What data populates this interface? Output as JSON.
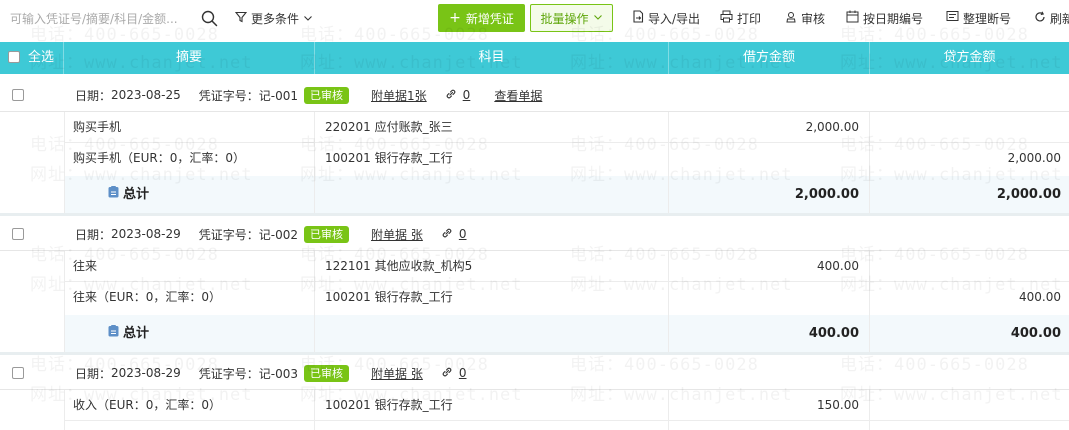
{
  "toolbar": {
    "search_placeholder": "可输入凭证号/摘要/科目/金额...",
    "more_filters": "更多条件",
    "new_voucher": "新增凭证",
    "new_plus": "+",
    "batch_ops": "批量操作",
    "import_export": "导入/导出",
    "print": "打印",
    "audit": "审核",
    "by_date_number": "按日期编号",
    "arrange_gaps": "整理断号",
    "refresh": "刷新"
  },
  "table_header": {
    "select_all": "全选",
    "summary": "摘要",
    "account": "科目",
    "debit": "借方金额",
    "credit": "贷方金额"
  },
  "labels": {
    "date_prefix": "日期：",
    "voucher_prefix": "凭证字号：",
    "total": "总计"
  },
  "watermark": {
    "phone": "电话：400-665-0028",
    "site": "网址：www.chanjet.net"
  },
  "vouchers": [
    {
      "date": "2023-08-25",
      "number": "记-001",
      "status": "已审核",
      "attachments": "附单据1张",
      "link_count": "0",
      "view_docs": "查看单据",
      "entries": [
        {
          "summary": "购买手机",
          "account": "220201 应付账款_张三",
          "debit": "2,000.00",
          "credit": ""
        },
        {
          "summary": "购买手机（EUR：0，汇率：0）",
          "account": "100201 银行存款_工行",
          "debit": "",
          "credit": "2,000.00"
        }
      ],
      "total_debit": "2,000.00",
      "total_credit": "2,000.00"
    },
    {
      "date": "2023-08-29",
      "number": "记-002",
      "status": "已审核",
      "attachments": "附单据 张",
      "link_count": "0",
      "entries": [
        {
          "summary": "往来",
          "account": "122101 其他应收款_机构5",
          "debit": "400.00",
          "credit": ""
        },
        {
          "summary": "往来（EUR：0，汇率：0）",
          "account": "100201 银行存款_工行",
          "debit": "",
          "credit": "400.00"
        }
      ],
      "total_debit": "400.00",
      "total_credit": "400.00"
    },
    {
      "date": "2023-08-29",
      "number": "记-003",
      "status": "已审核",
      "attachments": "附单据 张",
      "link_count": "0",
      "entries": [
        {
          "summary": "收入（EUR：0，汇率：0）",
          "account": "100201 银行存款_工行",
          "debit": "150.00",
          "credit": ""
        }
      ]
    }
  ],
  "colors": {
    "header_bg": "#3ec9d6",
    "accent_green": "#79c416",
    "total_bg": "#f3f9fc"
  }
}
